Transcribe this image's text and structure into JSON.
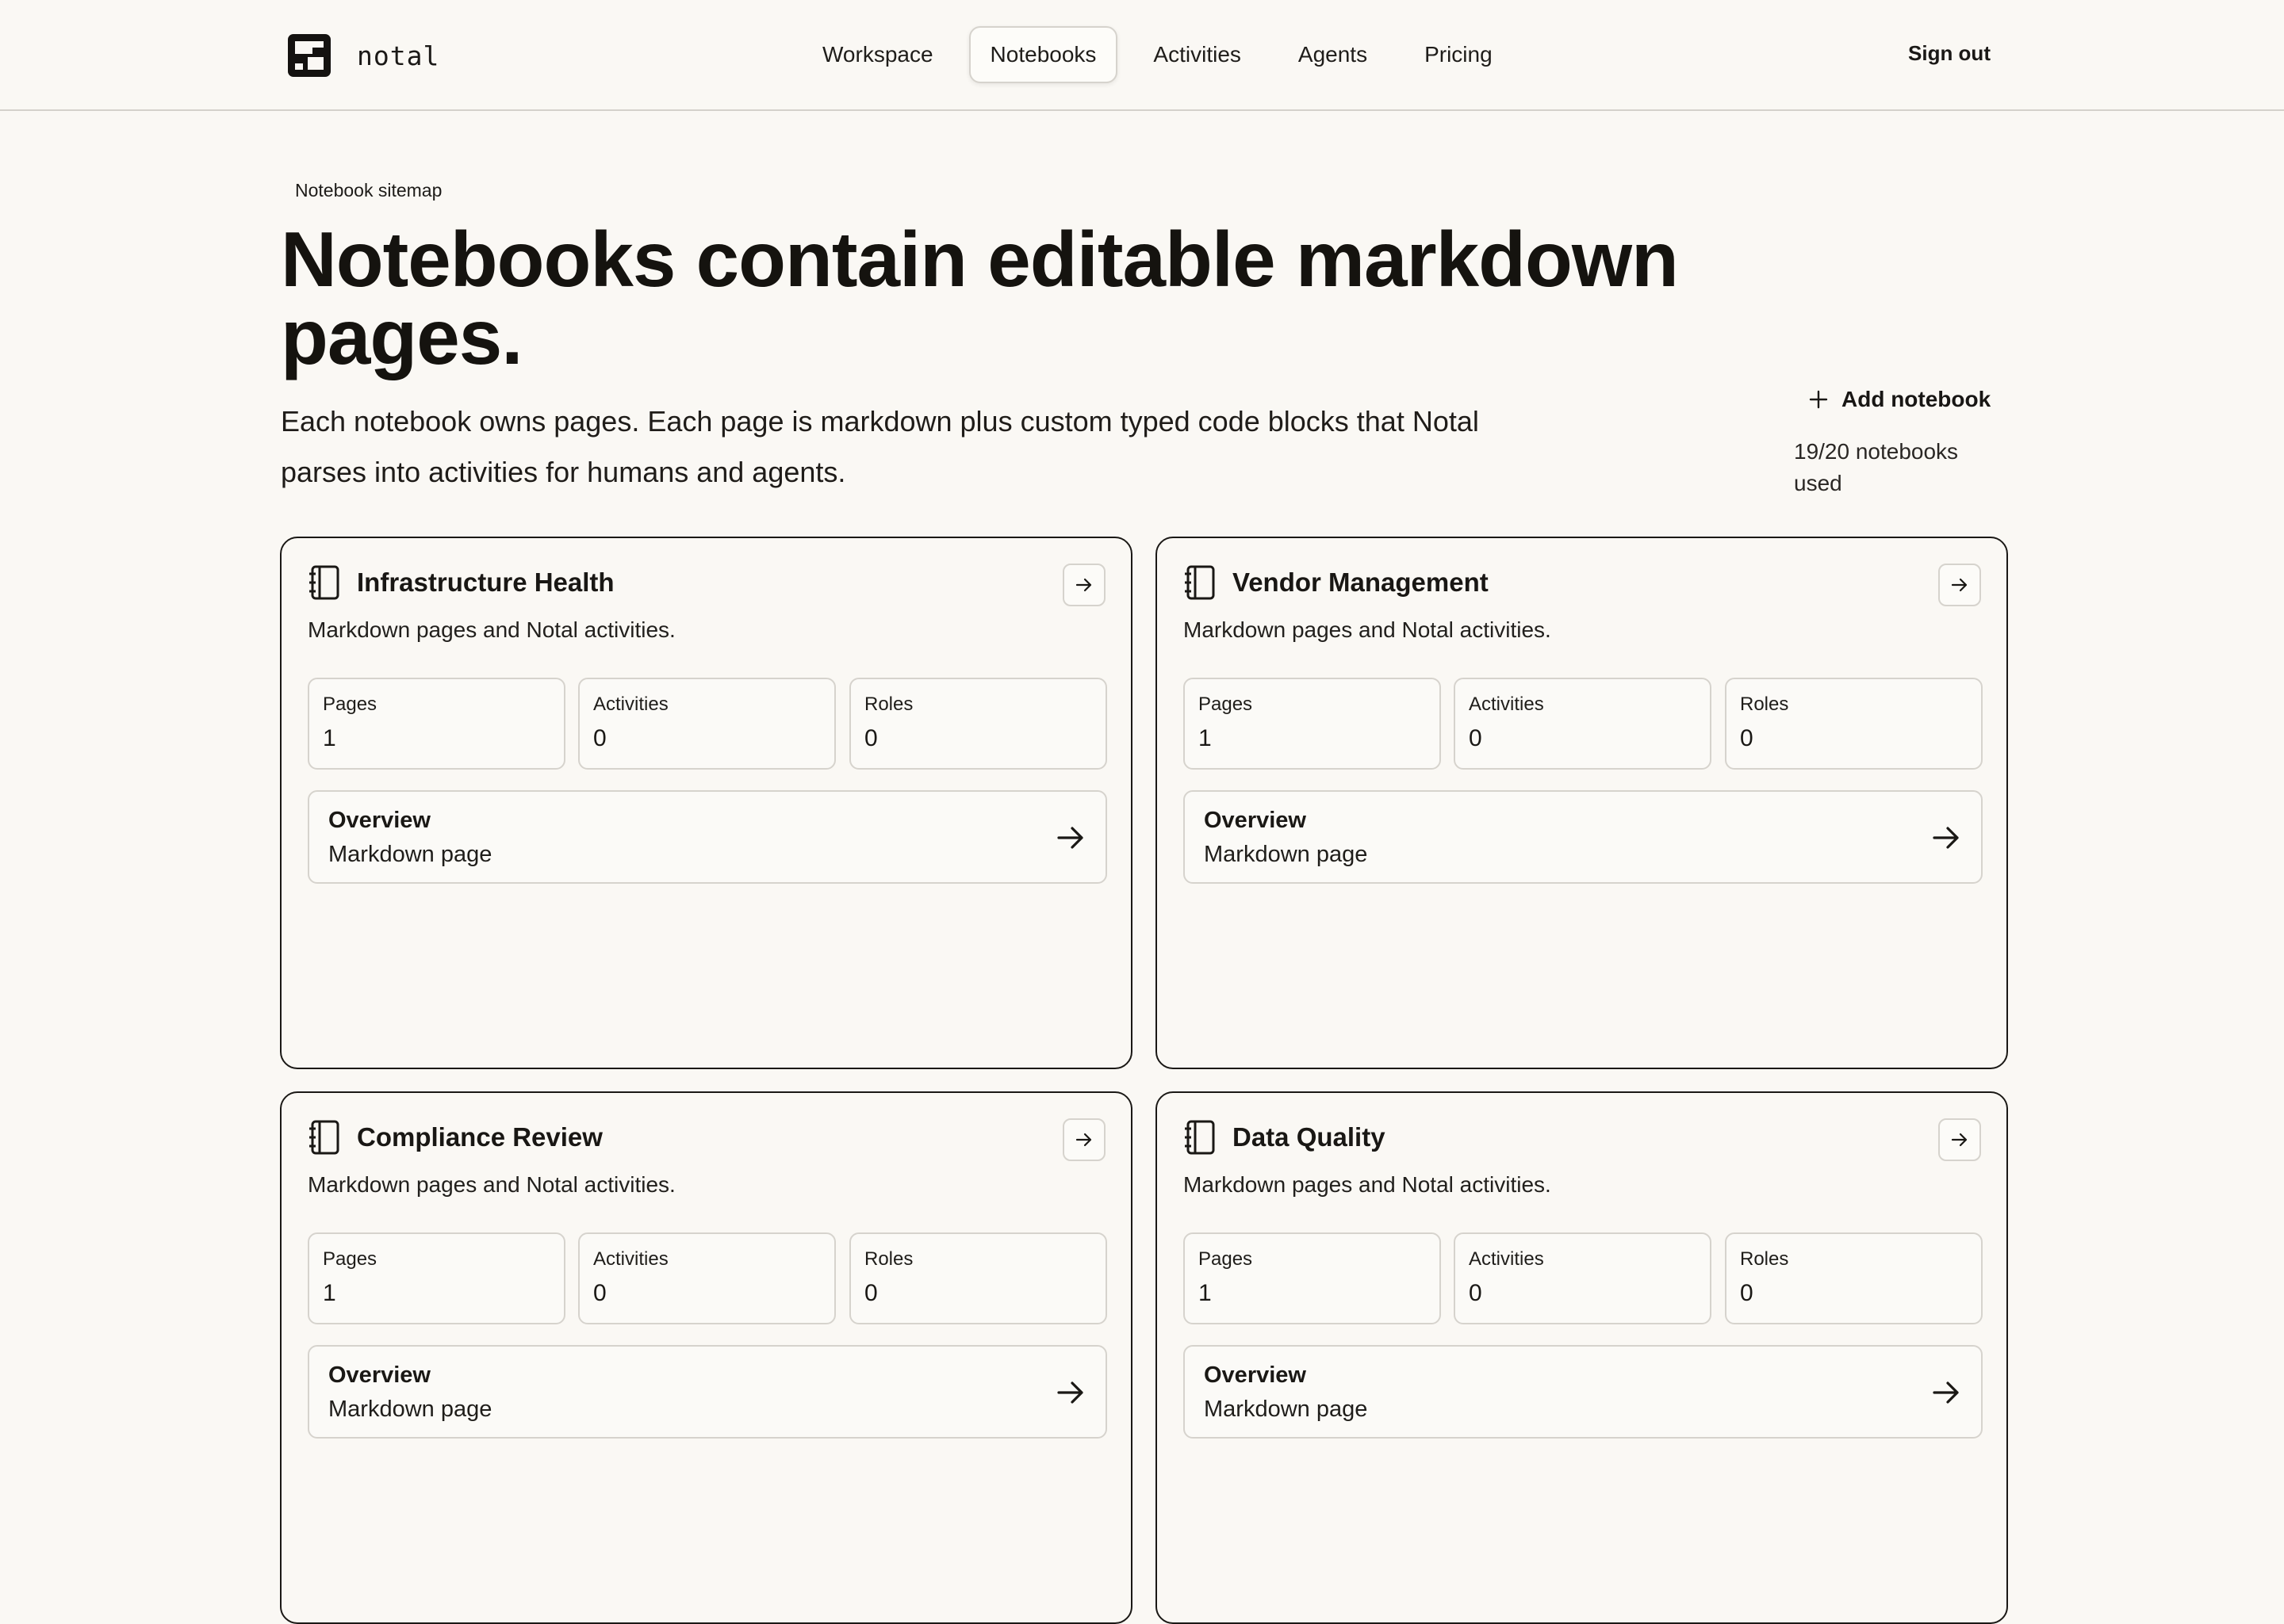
{
  "brand": {
    "name": "notal"
  },
  "nav": {
    "items": [
      {
        "label": "Workspace",
        "active": false
      },
      {
        "label": "Notebooks",
        "active": true
      },
      {
        "label": "Activities",
        "active": false
      },
      {
        "label": "Agents",
        "active": false
      },
      {
        "label": "Pricing",
        "active": false
      }
    ],
    "signout_label": "Sign out"
  },
  "hero": {
    "eyebrow": "Notebook sitemap",
    "headline": "Notebooks contain editable markdown pages.",
    "lead": "Each notebook owns pages. Each page is markdown plus custom typed code blocks that Notal parses into activities for humans and agents.",
    "add_label": "Add notebook",
    "quota": "19/20 notebooks used"
  },
  "stat_labels": {
    "pages": "Pages",
    "activities": "Activities",
    "roles": "Roles"
  },
  "notebooks": [
    {
      "title": "Infrastructure Health",
      "description": "Markdown pages and Notal activities.",
      "pages": "1",
      "activities": "0",
      "roles": "0",
      "page_list": [
        {
          "title": "Overview",
          "type": "Markdown page"
        }
      ]
    },
    {
      "title": "Vendor Management",
      "description": "Markdown pages and Notal activities.",
      "pages": "1",
      "activities": "0",
      "roles": "0",
      "page_list": [
        {
          "title": "Overview",
          "type": "Markdown page"
        }
      ]
    },
    {
      "title": "Compliance Review",
      "description": "Markdown pages and Notal activities.",
      "pages": "1",
      "activities": "0",
      "roles": "0",
      "page_list": [
        {
          "title": "Overview",
          "type": "Markdown page"
        }
      ]
    },
    {
      "title": "Data Quality",
      "description": "Markdown pages and Notal activities.",
      "pages": "1",
      "activities": "0",
      "roles": "0",
      "page_list": [
        {
          "title": "Overview",
          "type": "Markdown page"
        }
      ]
    }
  ],
  "icons": {
    "logo": "notal-logo-icon",
    "notebook": "notebook-icon",
    "open": "arrow-right-icon",
    "add": "plus-icon"
  },
  "colors": {
    "background": "#faf8f4",
    "text": "#181614",
    "border": "#d6d3cd"
  }
}
